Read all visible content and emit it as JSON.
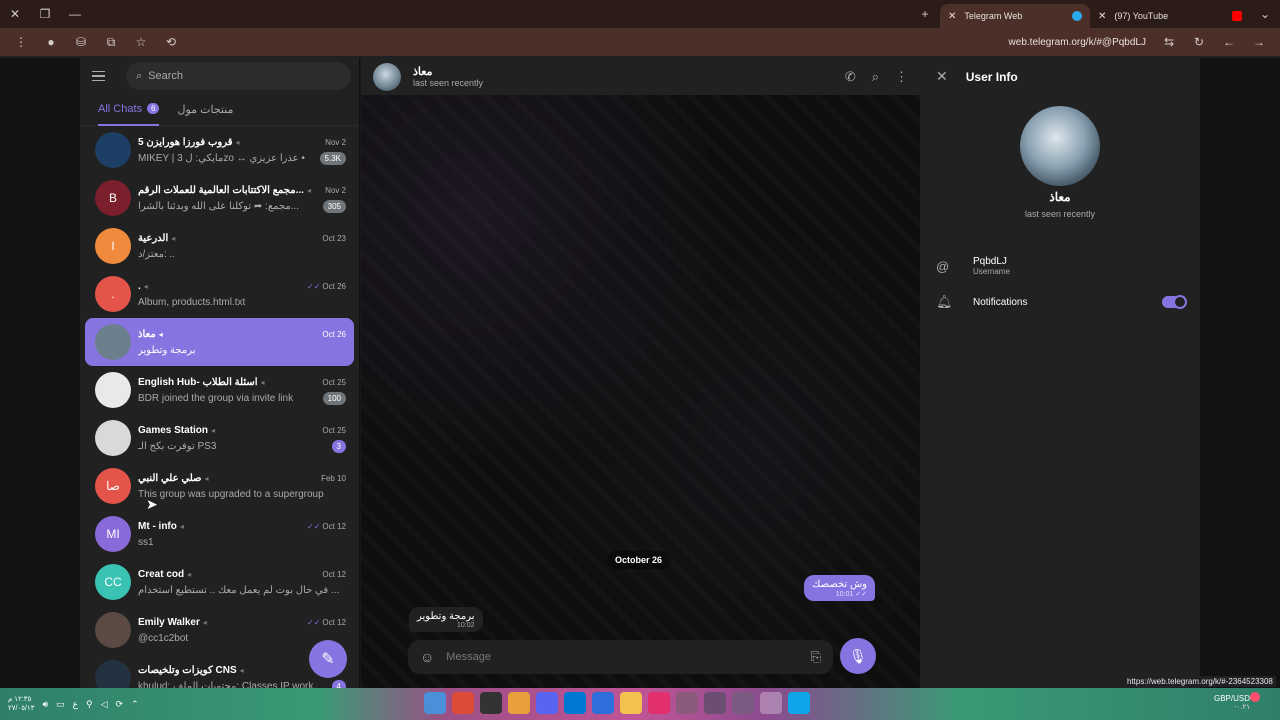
{
  "browser": {
    "tabs": [
      {
        "title": "Telegram Web",
        "active": true
      },
      {
        "title": "(97) YouTube",
        "active": false
      }
    ],
    "url": "web.telegram.org/k/#@PqbdLJ",
    "status_url": "https://web.telegram.org/k/#-2364523308"
  },
  "sidebar": {
    "search_placeholder": "Search",
    "folders": [
      {
        "label": "All Chats",
        "badge": "6",
        "active": true
      },
      {
        "label": "منتجات مول",
        "badge": "",
        "active": false
      }
    ],
    "chats": [
      {
        "name": "قروب فورزا هورايزن 5",
        "date": "Nov 2",
        "preview": "MIKEY | مايكي: ل 3zo ↔ عذراً عزيزي •",
        "unread": "5.3K",
        "unread_accent": false,
        "read_tick": false,
        "avatar_color": "#1d3f66",
        "avatar_text": ""
      },
      {
        "name": "مجمع الاكتتابات العالمية للعملات الرقم...",
        "date": "Nov 2",
        "preview": "مجمع: ➦ توكلنا على الله وبدئنا بالشرا...",
        "unread": "305",
        "unread_accent": false,
        "read_tick": false,
        "avatar_color": "#7a1f2b",
        "avatar_text": "B"
      },
      {
        "name": "الدرعية",
        "date": "Oct 23",
        "preview": "معتز/د: ..",
        "unread": "",
        "unread_accent": false,
        "read_tick": false,
        "avatar_color": "#f08a3c",
        "avatar_text": "I"
      },
      {
        "name": ".",
        "date": "Oct 26",
        "preview": "Album, products.html.txt",
        "unread": "",
        "unread_accent": false,
        "read_tick": true,
        "avatar_color": "#e5544b",
        "avatar_text": "."
      },
      {
        "name": "معاذ",
        "date": "Oct 26",
        "preview": "برمجة وتطوير",
        "unread": "",
        "unread_accent": false,
        "read_tick": false,
        "avatar_color": "#6c7f8c",
        "avatar_text": "",
        "selected": true
      },
      {
        "name": "English Hub- اسئلة الطلاب",
        "date": "Oct 25",
        "preview": "BDR joined the group via invite link",
        "unread": "100",
        "unread_accent": false,
        "read_tick": false,
        "avatar_color": "#e9e9e9",
        "avatar_text": ""
      },
      {
        "name": "Games Station",
        "date": "Oct 25",
        "preview": "توفرت بكج الـ PS3",
        "unread": "3",
        "unread_accent": true,
        "read_tick": false,
        "avatar_color": "#d9d9d9",
        "avatar_text": ""
      },
      {
        "name": "صلي علي النبي",
        "date": "Feb 10",
        "preview": "This group was upgraded to a supergroup",
        "unread": "",
        "unread_accent": false,
        "read_tick": false,
        "avatar_color": "#e5544b",
        "avatar_text": "صا"
      },
      {
        "name": "Mt - info",
        "date": "Oct 12",
        "preview": "ss1",
        "unread": "",
        "unread_accent": false,
        "read_tick": true,
        "avatar_color": "#8a6ad8",
        "avatar_text": "MI"
      },
      {
        "name": "Creat cod",
        "date": "Oct 12",
        "preview": "في حال بوت لم يعمل معك .. تستطيع استخدام ...",
        "unread": "",
        "unread_accent": false,
        "read_tick": false,
        "avatar_color": "#3ac3b3",
        "avatar_text": "CC"
      },
      {
        "name": "Emily Walker",
        "date": "Oct 12",
        "preview": "@cc1c2bot",
        "unread": "",
        "unread_accent": false,
        "read_tick": true,
        "avatar_color": "#5b4a44",
        "avatar_text": ""
      },
      {
        "name": "كويزات وتلخيصات CNS",
        "date": "",
        "preview": "khulud: محتويات الملف: Classes IP work...",
        "unread": "4",
        "unread_accent": true,
        "read_tick": false,
        "avatar_color": "#233241",
        "avatar_text": ""
      }
    ]
  },
  "chat": {
    "name": "معاذ",
    "status": "last seen recently",
    "date_chip": "October 26",
    "messages": [
      {
        "text": "وش تخصصك",
        "time": "10:01",
        "outgoing": true
      },
      {
        "text": "برمجة وتطوير",
        "time": "10:02",
        "outgoing": false
      }
    ],
    "composer_placeholder": "Message"
  },
  "user_info": {
    "title": "User Info",
    "name": "معاذ",
    "status": "last seen recently",
    "username": "PqbdLJ",
    "username_label": "Username",
    "notifications_label": "Notifications",
    "notifications_on": true
  },
  "taskbar": {
    "time": "١٢:٣٥ م",
    "date": "٢٧/٠٥/١٣",
    "lang": "ع",
    "currency": "GBP/USD",
    "currency_change": "-٠.٢١"
  },
  "colors": {
    "accent": "#8774e1"
  }
}
